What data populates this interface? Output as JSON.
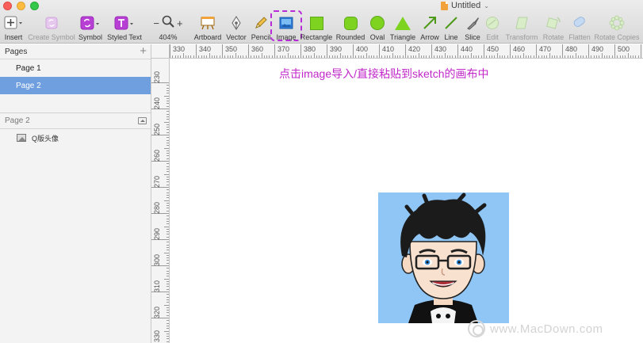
{
  "window": {
    "title": "Untitled",
    "title_caret": "⌄"
  },
  "toolbar": {
    "insert": "Insert",
    "create_symbol": "Create Symbol",
    "symbol": "Symbol",
    "styled_text": "Styled Text",
    "zoom_minus": "−",
    "zoom_plus": "+",
    "zoom_level": "404%",
    "artboard": "Artboard",
    "vector": "Vector",
    "pencil": "Pencil",
    "image": "Image",
    "rectangle": "Rectangle",
    "rounded": "Rounded",
    "oval": "Oval",
    "triangle": "Triangle",
    "arrow": "Arrow",
    "line": "Line",
    "slice": "Slice",
    "edit": "Edit",
    "transform": "Transform",
    "rotate": "Rotate",
    "flatten": "Flatten",
    "rotate_copies": "Rotate Copies"
  },
  "sidebar": {
    "pages_header": "Pages",
    "add_page": "+",
    "pages": [
      {
        "label": "Page 1",
        "selected": false
      },
      {
        "label": "Page 2",
        "selected": true
      }
    ],
    "layers_header": "Page 2",
    "layers": [
      {
        "label": "Q版头像",
        "icon": "image-layer-icon"
      }
    ]
  },
  "rulers": {
    "top": [
      "330",
      "340",
      "350",
      "360",
      "370",
      "380",
      "390",
      "400",
      "410",
      "420",
      "430",
      "440",
      "450",
      "460",
      "470",
      "480",
      "490",
      "500"
    ],
    "left": [
      "230",
      "240",
      "250",
      "260",
      "270",
      "280",
      "290",
      "300",
      "310",
      "320",
      "330"
    ]
  },
  "canvas": {
    "instruction": "点击image导入/直接粘贴到sketch的画布中"
  },
  "watermark": {
    "text": "www.MacDown.com"
  },
  "colors": {
    "accent_selected": "#6f9fdf",
    "instruction_text": "#c127c9",
    "highlight_dash": "#b52cd6",
    "shape_green": "#7ed321",
    "avatar_bg": "#8fc6f5"
  }
}
